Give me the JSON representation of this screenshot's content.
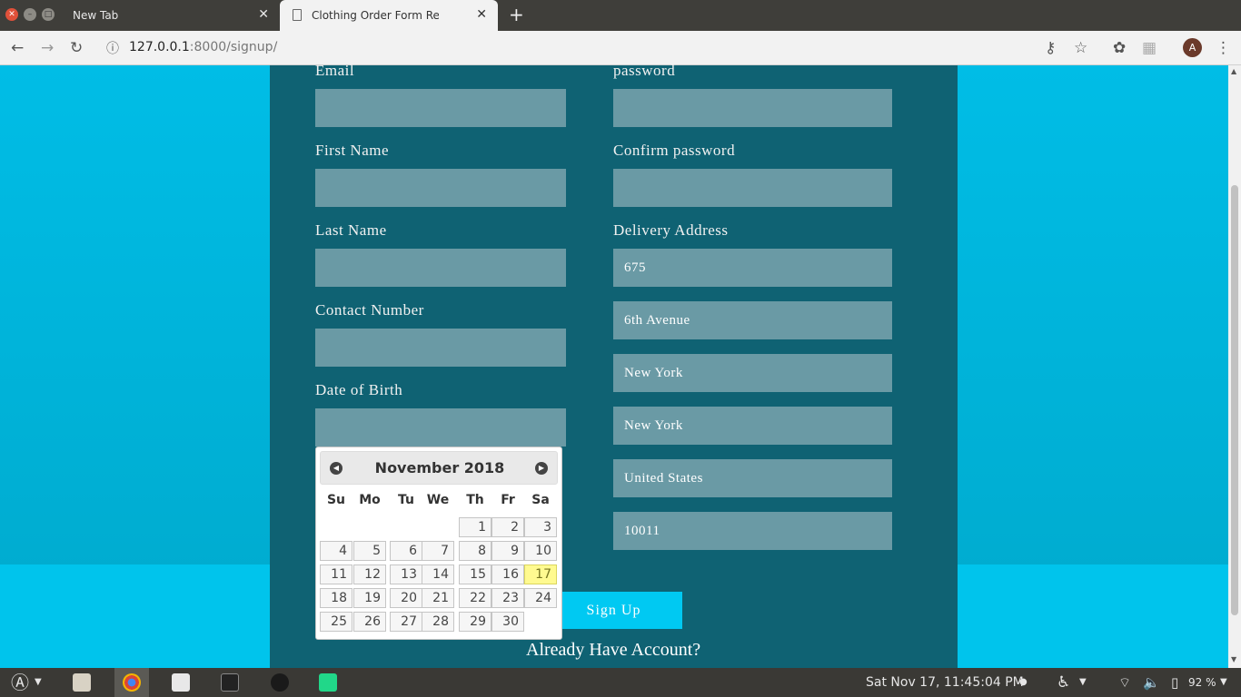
{
  "browser": {
    "tabs": [
      {
        "label": "New Tab",
        "close": "✕"
      },
      {
        "label": "Clothing Order Form Responsive",
        "close": "✕"
      }
    ],
    "new_tab": "+",
    "url_host": "127.0.0.1",
    "url_rest": ":8000/signup/",
    "avatar_letter": "A"
  },
  "form": {
    "email_label": "Email",
    "password_label": "password",
    "first_name_label": "First Name",
    "confirm_password_label": "Confirm password",
    "last_name_label": "Last Name",
    "delivery_address_label": "Delivery Address",
    "contact_number_label": "Contact Number",
    "dob_label": "Date of Birth",
    "address": {
      "house_number": "675",
      "street": "6th Avenue",
      "city": "New York",
      "state": "New York",
      "country": "United States",
      "zip": "10011"
    },
    "signup_label": "Sign Up",
    "already_label": "Already Have Account?"
  },
  "datepicker": {
    "title": "November 2018",
    "weekdays": [
      "Su",
      "Mo",
      "Tu",
      "We",
      "Th",
      "Fr",
      "Sa"
    ],
    "first_weekday_index": 4,
    "days_in_month": 30,
    "highlighted_day": 17
  },
  "taskbar": {
    "clock": "Sat Nov 17, 11:45:04 PM",
    "battery": "92 %"
  },
  "colors": {
    "page_bg": "#00b4d8",
    "panel_bg": "#0f6273",
    "field_bg": "#6a9aa5",
    "button_bg": "#00c9f2",
    "highlight": "#fffa90"
  }
}
